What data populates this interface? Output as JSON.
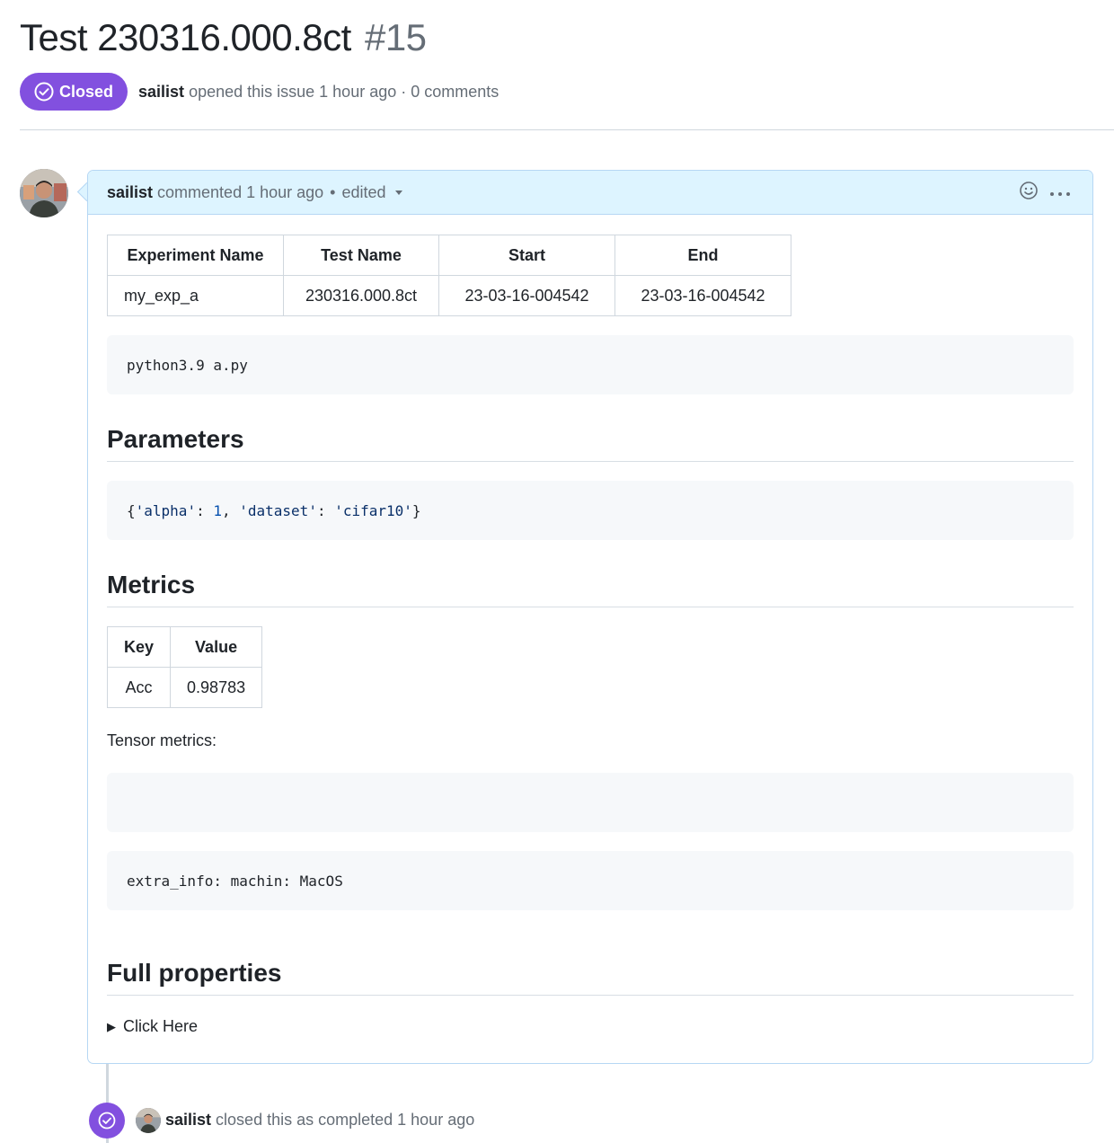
{
  "issue": {
    "title": "Test 230316.000.8ct",
    "number": "#15",
    "state": "Closed",
    "state_color": "#8250df",
    "author": "sailist",
    "meta": "opened this issue 1 hour ago · 0 comments"
  },
  "comment": {
    "author": "sailist",
    "action": "commented 1 hour ago",
    "separator": "•",
    "edited": "edited",
    "info_table": {
      "headers": [
        "Experiment Name",
        "Test Name",
        "Start",
        "End"
      ],
      "rows": [
        [
          "my_exp_a",
          "230316.000.8ct",
          "23-03-16-004542",
          "23-03-16-004542"
        ]
      ]
    },
    "command": "python3.9 a.py",
    "parameters_heading": "Parameters",
    "parameters_code": {
      "open": "{",
      "k1": "'alpha'",
      "colon1": ": ",
      "v1": "1",
      "comma": ", ",
      "k2": "'dataset'",
      "colon2": ": ",
      "v2": "'cifar10'",
      "close": "}"
    },
    "metrics_heading": "Metrics",
    "metrics_table": {
      "headers": [
        "Key",
        "Value"
      ],
      "rows": [
        [
          "Acc",
          "0.98783"
        ]
      ]
    },
    "tensor_label": "Tensor metrics:",
    "tensor_code": "",
    "extra_info": "extra_info: machin: MacOS",
    "full_heading": "Full properties",
    "details_summary": "Click Here"
  },
  "event": {
    "author": "sailist",
    "text": "closed this as completed 1 hour ago"
  },
  "icons": [
    "check-circle-icon",
    "smiley-icon",
    "kebab-icon",
    "caret-down-icon",
    "triangle-right-icon"
  ]
}
